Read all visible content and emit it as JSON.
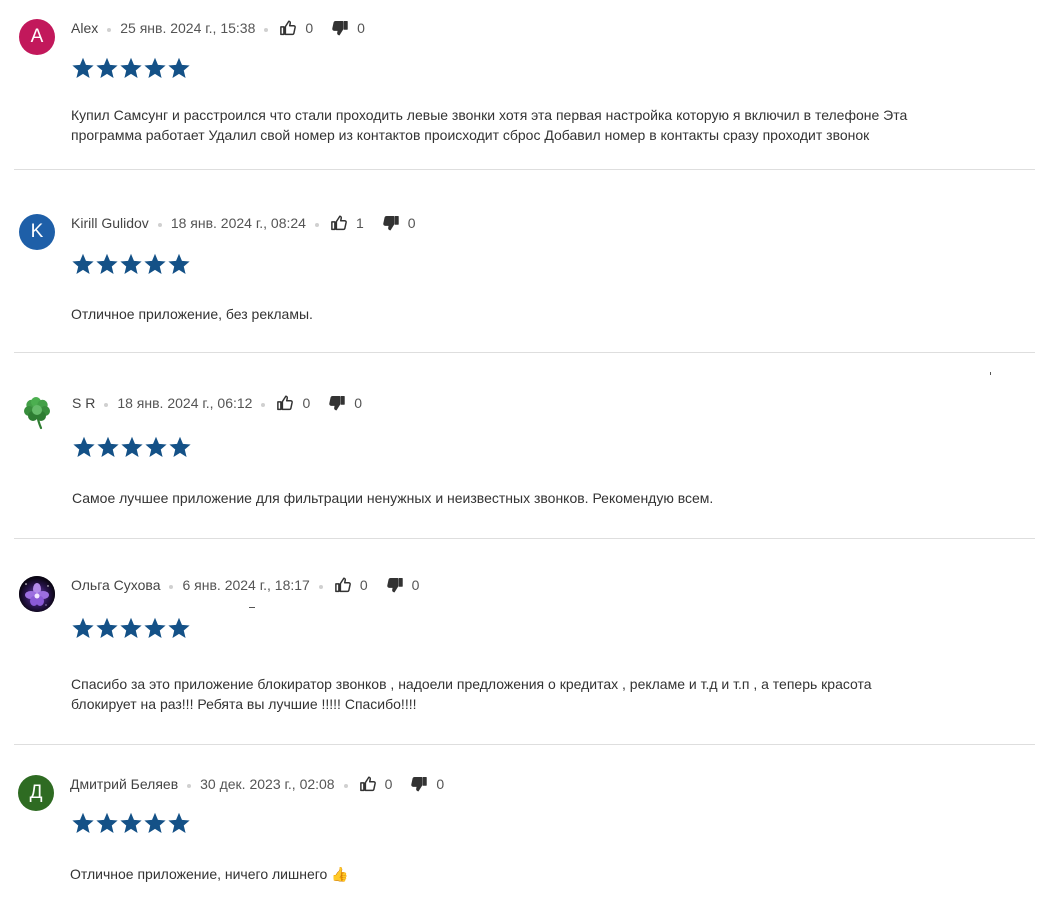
{
  "colors": {
    "star": "#145187",
    "avatar_alex": "#c2185b",
    "avatar_kirill": "#1e5fa8",
    "avatar_dmitry": "#2e6b22"
  },
  "reviews": [
    {
      "avatar_letter": "A",
      "author": "Alex",
      "date": "25 янв. 2024 г., 15:38",
      "likes": "0",
      "dislikes": "0",
      "rating": 5,
      "text": "Купил Самсунг и расстроился что стали проходить левые звонки хотя эта первая настройка которую я включил в телефоне Эта программа работает Удалил свой номер из контактов происходит сброс Добавил номер в контакты сразу проходит звонок"
    },
    {
      "avatar_letter": "K",
      "author": "Kirill Gulidov",
      "date": "18 янв. 2024 г., 08:24",
      "likes": "1",
      "dislikes": "0",
      "rating": 5,
      "text": "Отличное приложение, без рекламы."
    },
    {
      "avatar_icon": "shamrock-icon",
      "author": "S R",
      "date": "18 янв. 2024 г., 06:12",
      "likes": "0",
      "dislikes": "0",
      "rating": 5,
      "text": "Самое лучшее приложение для фильтрации ненужных и неизвестных звонков. Рекомендую всем."
    },
    {
      "avatar_icon": "purple-flower-photo",
      "author": "Ольга Сухова",
      "date": "6 янв. 2024 г., 18:17",
      "likes": "0",
      "dislikes": "0",
      "rating": 5,
      "text": "Спасибо за это приложение блокиратор звонков , надоели предложения о кредитах , рекламе и т.д и т.п , а теперь красота блокирует на раз!!! Ребята вы лучшие !!!!! Спасибо!!!!"
    },
    {
      "avatar_letter": "Д",
      "author": "Дмитрий Беляев",
      "date": "30 дек. 2023 г., 02:08",
      "likes": "0",
      "dislikes": "0",
      "rating": 5,
      "text": "Отличное приложение, ничего лишнего 👍"
    }
  ]
}
